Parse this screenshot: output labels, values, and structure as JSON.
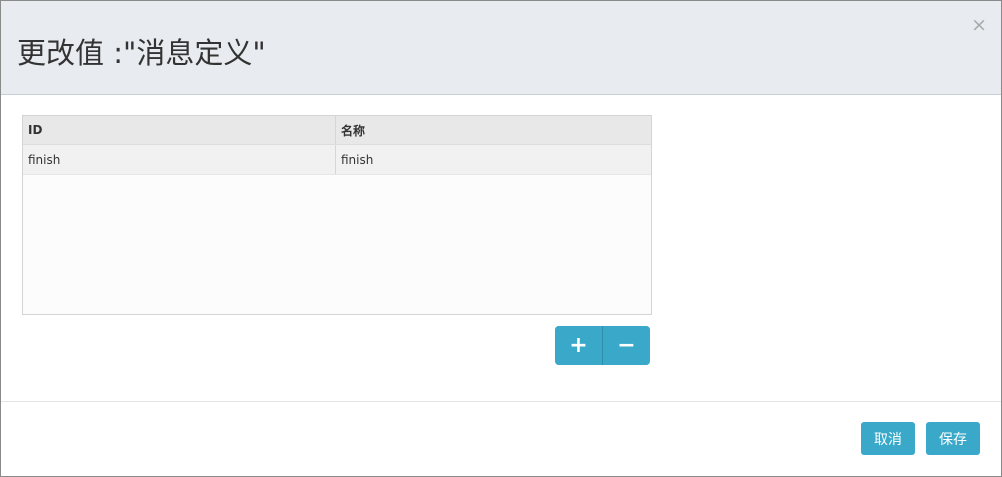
{
  "dialog": {
    "title": "更改值 :\"消息定义\"",
    "close_label": "×"
  },
  "grid": {
    "columns": [
      "ID",
      "名称"
    ],
    "rows": [
      [
        "finish",
        "finish"
      ]
    ]
  },
  "row_actions": {
    "add_label": "+",
    "remove_label": "−"
  },
  "footer": {
    "cancel_label": "取消",
    "save_label": "保存"
  },
  "colors": {
    "accent": "#3aa9c9",
    "header_bg": "#e8ecf0"
  }
}
